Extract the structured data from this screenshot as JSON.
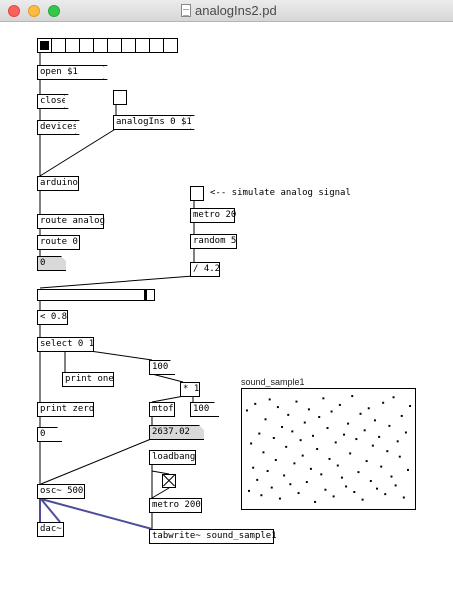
{
  "window": {
    "title": "analogIns2.pd"
  },
  "radio": {
    "cells": 10,
    "selected": 0
  },
  "messages": {
    "open": "open $1",
    "close": "close",
    "devices": "devices",
    "analogins": "analogIns 0 $1"
  },
  "objects": {
    "arduino": "arduino",
    "route_analog": "route analog",
    "route_0": "route 0",
    "metro_20": "metro 20",
    "random_5": "random 5",
    "div_42": "/ 4.2",
    "lt_08": "< 0.8",
    "select_01": "select 0 1",
    "print_one": "print one",
    "print_zero": "print zero",
    "mul_1": "* 1",
    "mtof": "mtof",
    "osc_500": "osc~ 500",
    "dac": "dac~",
    "loadbang": "loadbang",
    "metro_200": "metro 200",
    "tabwrite": "tabwrite~ sound_sample1"
  },
  "numbers": {
    "route_out": "0",
    "n100a": "100",
    "n100b": "100",
    "zero": "0",
    "freq": "2637.02"
  },
  "comment": "<-- simulate analog signal",
  "slider": {
    "value": 0.94
  },
  "array": {
    "name": "sound_sample1",
    "points": [
      0.85,
      0.12,
      0.55,
      0.33,
      0.91,
      0.22,
      0.64,
      0.08,
      0.47,
      0.77,
      0.3,
      0.95,
      0.15,
      0.6,
      0.4,
      0.88,
      0.05,
      0.7,
      0.26,
      0.52,
      0.81,
      0.18,
      0.66,
      0.37,
      0.93,
      0.1,
      0.58,
      0.44,
      0.74,
      0.2,
      0.86,
      0.32,
      0.62,
      0.02,
      0.5,
      0.79,
      0.27,
      0.96,
      0.13,
      0.69,
      0.41,
      0.84,
      0.07,
      0.56,
      0.35,
      0.9,
      0.24,
      0.63,
      0.16,
      0.73,
      0.46,
      0.98,
      0.11,
      0.59,
      0.29,
      0.82,
      0.04,
      0.67,
      0.39,
      0.87,
      0.21,
      0.53,
      0.76,
      0.14,
      0.61,
      0.34,
      0.92,
      0.09,
      0.48,
      0.71,
      0.25,
      0.97,
      0.17,
      0.57,
      0.43,
      0.8,
      0.06,
      0.65,
      0.31,
      0.89
    ]
  }
}
